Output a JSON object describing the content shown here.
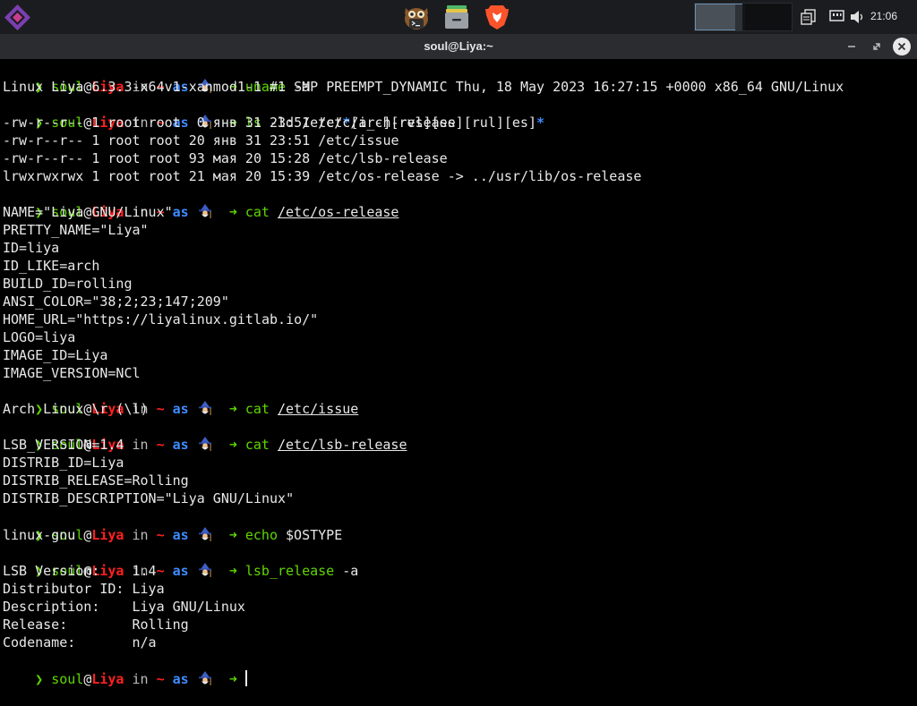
{
  "panel": {
    "launcher_icon": "liya-logo-icon",
    "tasks": [
      {
        "name": "terminal-owl-icon"
      },
      {
        "name": "file-manager-icon"
      },
      {
        "name": "brave-browser-icon"
      }
    ],
    "tray": [
      "clipboard-icon",
      "network-icon",
      "volume-icon"
    ],
    "clock": "21:06"
  },
  "window": {
    "title": "soul@Liya:~"
  },
  "prompt": {
    "arrow": "❯",
    "user": "soul",
    "at": "@",
    "host": "Liya",
    "in": "in",
    "dir": "~",
    "as": "as",
    "wizard_icon": "wizard-icon",
    "pointer": "➜"
  },
  "terminal": {
    "cmd1": {
      "name": "uname",
      "args": " -a"
    },
    "out1": "Linux Liya 6.3.3-x64v1-xanmod1-1 #1 SMP PREEMPT_DYNAMIC Thu, 18 May 2023 16:27:15 +0000 x86_64 GNU/Linux",
    "cmd2": {
      "name": "ls",
      "args_a": " -ld /etc/",
      "star1": "*",
      "args_b": "[i_-][rvs][es][rul][es]",
      "star2": "*"
    },
    "out2": [
      "-rw-r--r-- 1 root root  0 янв 31 23:51 /etc/arch-release",
      "-rw-r--r-- 1 root root 20 янв 31 23:51 /etc/issue",
      "-rw-r--r-- 1 root root 93 мая 20 15:28 /etc/lsb-release",
      "lrwxrwxrwx 1 root root 21 мая 20 15:39 /etc/os-release -> ../usr/lib/os-release"
    ],
    "cmd3": {
      "name": "cat",
      "path": "/etc/os-release"
    },
    "out3": [
      "NAME=\"Liya GNU/Linux\"",
      "PRETTY_NAME=\"Liya\"",
      "ID=liya",
      "ID_LIKE=arch",
      "BUILD_ID=rolling",
      "ANSI_COLOR=\"38;2;23;147;209\"",
      "HOME_URL=\"https://liyalinux.gitlab.io/\"",
      "LOGO=liya",
      "IMAGE_ID=Liya",
      "IMAGE_VERSION=NCl"
    ],
    "cmd4": {
      "name": "cat",
      "path": "/etc/issue"
    },
    "out4": "Arch Linux \\r (\\l)",
    "cmd5": {
      "name": "cat",
      "path": "/etc/lsb-release"
    },
    "out5": [
      "LSB_VERSION=1.4",
      "DISTRIB_ID=Liya",
      "DISTRIB_RELEASE=Rolling",
      "DISTRIB_DESCRIPTION=\"Liya GNU/Linux\""
    ],
    "cmd6": {
      "name": "echo",
      "args": " $OSTYPE"
    },
    "out6": "linux-gnu",
    "cmd7": {
      "name": "lsb_release",
      "args": " -a"
    },
    "out7": [
      "LSB Version:    1.4",
      "Distributor ID: Liya",
      "Description:    Liya GNU/Linux",
      "Release:        Rolling",
      "Codename:       n/a"
    ]
  }
}
